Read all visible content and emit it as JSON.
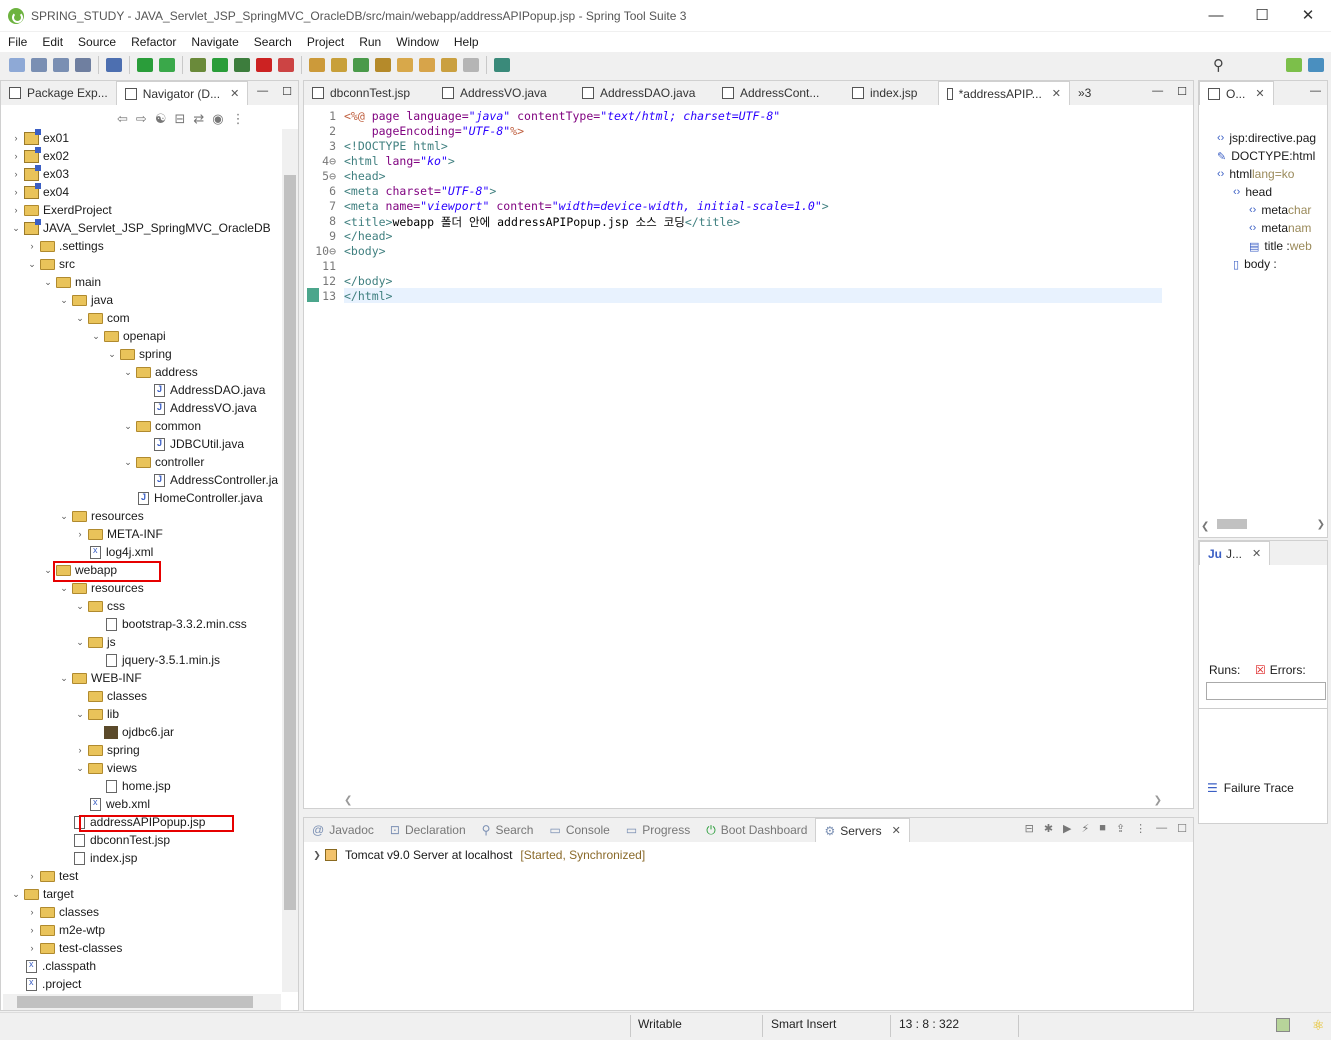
{
  "window": {
    "title": "SPRING_STUDY - JAVA_Servlet_JSP_SpringMVC_OracleDB/src/main/webapp/addressAPIPopup.jsp - Spring Tool Suite 3"
  },
  "menu": [
    "File",
    "Edit",
    "Source",
    "Refactor",
    "Navigate",
    "Search",
    "Project",
    "Run",
    "Window",
    "Help"
  ],
  "left_panel": {
    "tabs": [
      {
        "label": "Package Exp..."
      },
      {
        "label": "Navigator (D..."
      }
    ],
    "tree": [
      {
        "label": "ex01",
        "depth": 0,
        "icon": "project",
        "exp": "closed"
      },
      {
        "label": "ex02",
        "depth": 0,
        "icon": "project",
        "exp": "closed"
      },
      {
        "label": "ex03",
        "depth": 0,
        "icon": "project",
        "exp": "closed"
      },
      {
        "label": "ex04",
        "depth": 0,
        "icon": "project",
        "exp": "closed"
      },
      {
        "label": "ExerdProject",
        "depth": 0,
        "icon": "folder",
        "exp": "closed"
      },
      {
        "label": "JAVA_Servlet_JSP_SpringMVC_OracleDB",
        "depth": 0,
        "icon": "project",
        "exp": "open"
      },
      {
        "label": ".settings",
        "depth": 1,
        "icon": "folder",
        "exp": "closed"
      },
      {
        "label": "src",
        "depth": 1,
        "icon": "folder",
        "exp": "open"
      },
      {
        "label": "main",
        "depth": 2,
        "icon": "folder",
        "exp": "open"
      },
      {
        "label": "java",
        "depth": 3,
        "icon": "folder",
        "exp": "open"
      },
      {
        "label": "com",
        "depth": 4,
        "icon": "folder",
        "exp": "open"
      },
      {
        "label": "openapi",
        "depth": 5,
        "icon": "folder",
        "exp": "open"
      },
      {
        "label": "spring",
        "depth": 6,
        "icon": "folder",
        "exp": "open"
      },
      {
        "label": "address",
        "depth": 7,
        "icon": "folder",
        "exp": "open"
      },
      {
        "label": "AddressDAO.java",
        "depth": 8,
        "icon": "java",
        "exp": "none"
      },
      {
        "label": "AddressVO.java",
        "depth": 8,
        "icon": "java",
        "exp": "none"
      },
      {
        "label": "common",
        "depth": 7,
        "icon": "folder",
        "exp": "open"
      },
      {
        "label": "JDBCUtil.java",
        "depth": 8,
        "icon": "java",
        "exp": "none"
      },
      {
        "label": "controller",
        "depth": 7,
        "icon": "folder",
        "exp": "open"
      },
      {
        "label": "AddressController.ja",
        "depth": 8,
        "icon": "java",
        "exp": "none"
      },
      {
        "label": "HomeController.java",
        "depth": 7,
        "icon": "java",
        "exp": "none"
      },
      {
        "label": "resources",
        "depth": 3,
        "icon": "folder",
        "exp": "open"
      },
      {
        "label": "META-INF",
        "depth": 4,
        "icon": "folder",
        "exp": "closed"
      },
      {
        "label": "log4j.xml",
        "depth": 4,
        "icon": "xml",
        "exp": "none"
      },
      {
        "label": "webapp",
        "depth": 2,
        "icon": "folder",
        "exp": "open"
      },
      {
        "label": "resources",
        "depth": 3,
        "icon": "folder",
        "exp": "open"
      },
      {
        "label": "css",
        "depth": 4,
        "icon": "folder",
        "exp": "open"
      },
      {
        "label": "bootstrap-3.3.2.min.css",
        "depth": 5,
        "icon": "file",
        "exp": "none"
      },
      {
        "label": "js",
        "depth": 4,
        "icon": "folder",
        "exp": "open"
      },
      {
        "label": "jquery-3.5.1.min.js",
        "depth": 5,
        "icon": "file",
        "exp": "none"
      },
      {
        "label": "WEB-INF",
        "depth": 3,
        "icon": "folder",
        "exp": "open"
      },
      {
        "label": "classes",
        "depth": 4,
        "icon": "folder",
        "exp": "none"
      },
      {
        "label": "lib",
        "depth": 4,
        "icon": "folder",
        "exp": "open"
      },
      {
        "label": "ojdbc6.jar",
        "depth": 5,
        "icon": "jar",
        "exp": "none"
      },
      {
        "label": "spring",
        "depth": 4,
        "icon": "folder",
        "exp": "closed"
      },
      {
        "label": "views",
        "depth": 4,
        "icon": "folder",
        "exp": "open"
      },
      {
        "label": "home.jsp",
        "depth": 5,
        "icon": "file",
        "exp": "none"
      },
      {
        "label": "web.xml",
        "depth": 4,
        "icon": "xml",
        "exp": "none"
      },
      {
        "label": "addressAPIPopup.jsp",
        "depth": 3,
        "icon": "file",
        "exp": "none"
      },
      {
        "label": "dbconnTest.jsp",
        "depth": 3,
        "icon": "file",
        "exp": "none"
      },
      {
        "label": "index.jsp",
        "depth": 3,
        "icon": "file",
        "exp": "none"
      },
      {
        "label": "test",
        "depth": 1,
        "icon": "folder",
        "exp": "closed"
      },
      {
        "label": "target",
        "depth": 0,
        "icon": "folder",
        "exp": "open"
      },
      {
        "label": "classes",
        "depth": 1,
        "icon": "folder",
        "exp": "closed"
      },
      {
        "label": "m2e-wtp",
        "depth": 1,
        "icon": "folder",
        "exp": "closed"
      },
      {
        "label": "test-classes",
        "depth": 1,
        "icon": "folder",
        "exp": "closed"
      },
      {
        "label": ".classpath",
        "depth": 0,
        "icon": "xml",
        "exp": "none"
      },
      {
        "label": ".project",
        "depth": 0,
        "icon": "xml",
        "exp": "none"
      }
    ]
  },
  "editor": {
    "tabs": [
      {
        "label": "dbconnTest.jsp",
        "active": false
      },
      {
        "label": "AddressVO.java",
        "active": false
      },
      {
        "label": "AddressDAO.java",
        "active": false
      },
      {
        "label": "AddressCont...",
        "active": false
      },
      {
        "label": "index.jsp",
        "active": false
      },
      {
        "label": "*addressAPIP...",
        "active": true
      }
    ],
    "overflow": "»3",
    "lines": [
      {
        "n": "1",
        "parts": [
          [
            "dir",
            "<%@ "
          ],
          [
            "att",
            "page "
          ],
          [
            "att",
            "language="
          ],
          [
            "val",
            "\"java\""
          ],
          [
            "att",
            " contentType="
          ],
          [
            "val",
            "\"text/html; charset=UTF-8\""
          ]
        ]
      },
      {
        "n": "2",
        "parts": [
          [
            "att",
            "    pageEncoding="
          ],
          [
            "val",
            "\"UTF-8\""
          ],
          [
            "dir",
            "%>"
          ]
        ]
      },
      {
        "n": "3",
        "parts": [
          [
            "tag",
            "<!DOCTYPE html>"
          ]
        ]
      },
      {
        "n": "4⊖",
        "parts": [
          [
            "tag",
            "<html "
          ],
          [
            "att",
            "lang="
          ],
          [
            "val",
            "\"ko\""
          ],
          [
            "tag",
            ">"
          ]
        ]
      },
      {
        "n": "5⊖",
        "parts": [
          [
            "tag",
            "<head>"
          ]
        ]
      },
      {
        "n": "6",
        "parts": [
          [
            "tag",
            "<meta "
          ],
          [
            "att",
            "charset="
          ],
          [
            "val",
            "\"UTF-8\""
          ],
          [
            "tag",
            ">"
          ]
        ]
      },
      {
        "n": "7",
        "parts": [
          [
            "tag",
            "<meta "
          ],
          [
            "att",
            "name="
          ],
          [
            "val",
            "\"viewport\""
          ],
          [
            "att",
            " content="
          ],
          [
            "val",
            "\"width=device-width, initial-scale=1.0\""
          ],
          [
            "tag",
            ">"
          ]
        ]
      },
      {
        "n": "8",
        "parts": [
          [
            "tag",
            "<title>"
          ],
          [
            "txt",
            "webapp 폴더 안에 addressAPIPopup.jsp 소스 코딩"
          ],
          [
            "tag",
            "</title>"
          ]
        ]
      },
      {
        "n": "9",
        "parts": [
          [
            "tag",
            "</head>"
          ]
        ]
      },
      {
        "n": "10⊖",
        "parts": [
          [
            "tag",
            "<body>"
          ]
        ]
      },
      {
        "n": "11",
        "parts": []
      },
      {
        "n": "12",
        "parts": [
          [
            "tag",
            "</body>"
          ]
        ]
      },
      {
        "n": "13",
        "parts": [
          [
            "tag",
            "</html>"
          ]
        ]
      }
    ]
  },
  "bottom_panel": {
    "tabs": [
      "Javadoc",
      "Declaration",
      "Search",
      "Console",
      "Progress",
      "Boot Dashboard",
      "Servers"
    ],
    "server": {
      "name": "Tomcat v9.0 Server at localhost",
      "state": "[Started, Synchronized]"
    }
  },
  "outline": {
    "tab": "O...",
    "items": [
      {
        "label": "jsp:directive.pag",
        "depth": 0,
        "dim": ""
      },
      {
        "label": "DOCTYPE:html",
        "depth": 0,
        "dim": ""
      },
      {
        "label": "html ",
        "depth": 0,
        "dim": "lang=ko"
      },
      {
        "label": "head",
        "depth": 1,
        "dim": ""
      },
      {
        "label": "meta ",
        "depth": 2,
        "dim": "char"
      },
      {
        "label": "meta ",
        "depth": 2,
        "dim": "nam"
      },
      {
        "label": "title : ",
        "depth": 2,
        "dim": "web"
      },
      {
        "label": "body : ",
        "depth": 1,
        "dim": ""
      }
    ]
  },
  "junit": {
    "tab": "J...",
    "runs_label": "Runs:",
    "errors_label": "Errors:",
    "failure_trace": "Failure Trace"
  },
  "status": {
    "writable": "Writable",
    "insert": "Smart Insert",
    "position": "13 : 8 : 322"
  }
}
